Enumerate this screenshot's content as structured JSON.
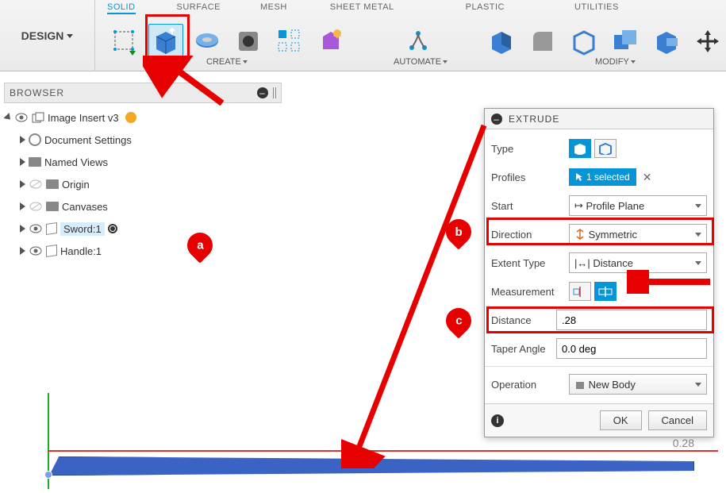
{
  "design_menu": "DESIGN",
  "tabs": {
    "solid": "SOLID",
    "surface": "SURFACE",
    "mesh": "MESH",
    "sheet_metal": "SHEET METAL",
    "plastic": "PLASTIC",
    "utilities": "UTILITIES"
  },
  "ribbon_labels": {
    "create": "CREATE",
    "automate": "AUTOMATE",
    "modify": "MODIFY"
  },
  "browser": {
    "title": "BROWSER",
    "root": "Image Insert v3",
    "items": [
      {
        "label": "Document Settings"
      },
      {
        "label": "Named Views"
      },
      {
        "label": "Origin"
      },
      {
        "label": "Canvases"
      },
      {
        "label": "Sword:1"
      },
      {
        "label": "Handle:1"
      }
    ]
  },
  "extrude": {
    "title": "EXTRUDE",
    "rows": {
      "type": "Type",
      "profiles": "Profiles",
      "profiles_value": "1 selected",
      "start": "Start",
      "start_value": "Profile Plane",
      "direction": "Direction",
      "direction_value": "Symmetric",
      "extent_type": "Extent Type",
      "extent_value": "Distance",
      "measurement": "Measurement",
      "distance": "Distance",
      "distance_value": ".28",
      "taper": "Taper Angle",
      "taper_value": "0.0 deg",
      "operation": "Operation",
      "operation_value": "New Body"
    },
    "buttons": {
      "ok": "OK",
      "cancel": "Cancel"
    }
  },
  "canvas": {
    "dim": "0.28"
  },
  "callouts": {
    "a": "a",
    "b": "b",
    "c": "c"
  }
}
